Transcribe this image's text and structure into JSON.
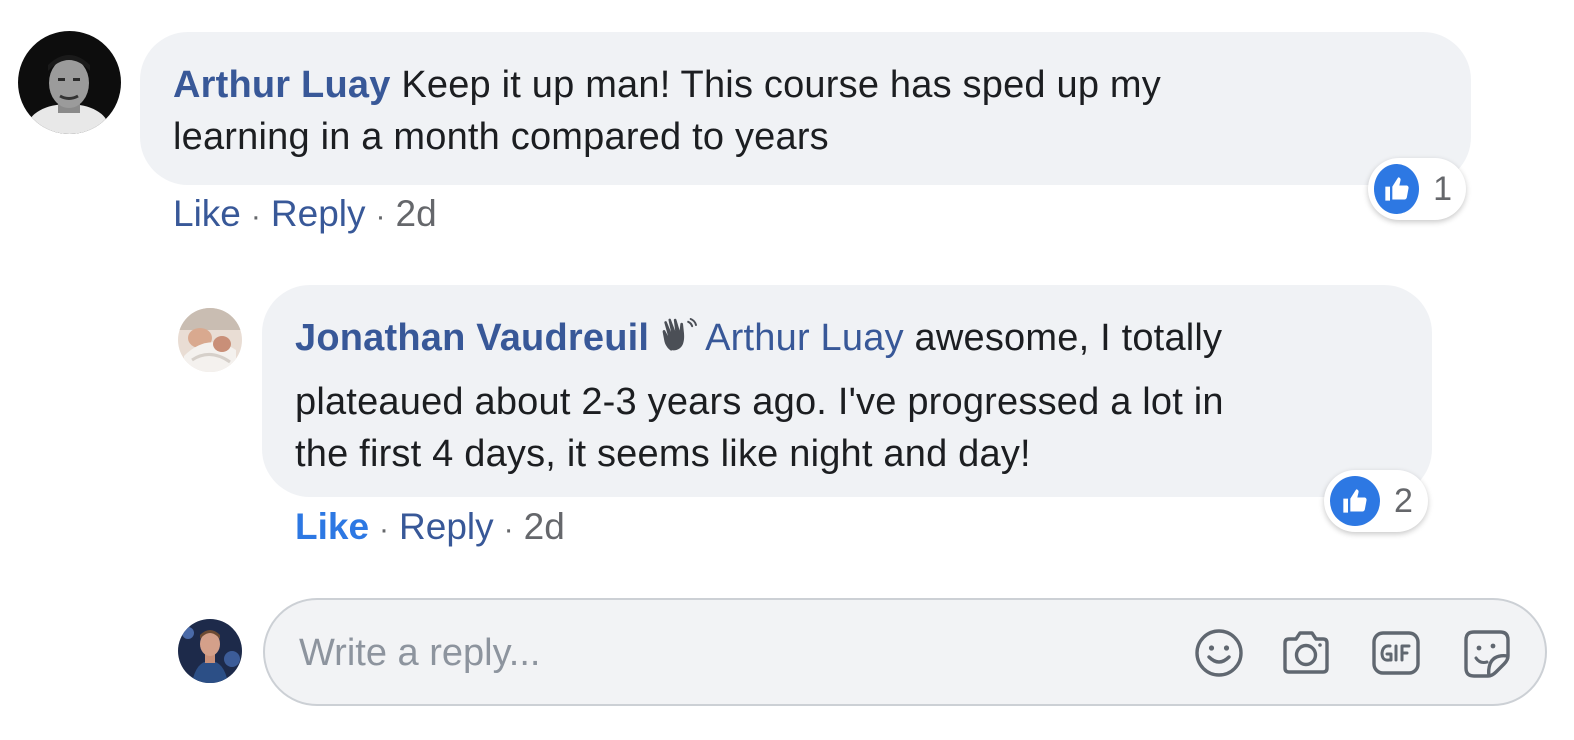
{
  "comment": {
    "author": "Arthur Luay",
    "text": "Keep it up man! This course has sped up my",
    "text_line2": "learning in a month compared to years",
    "reaction_count": "1",
    "actions": {
      "like": "Like",
      "reply": "Reply",
      "time": "2d",
      "separator": "·"
    }
  },
  "reply": {
    "author": "Jonathan Vaudreuil",
    "mention": "Arthur Luay",
    "text": "awesome, I totally",
    "text_line2": "plateaued about 2-3 years ago. I've progressed a lot in",
    "text_line3": "the first 4 days, it seems like night and day!",
    "reaction_count": "2",
    "actions": {
      "like": "Like",
      "reply": "Reply",
      "time": "2d",
      "separator": "·"
    }
  },
  "composer": {
    "placeholder": "Write a reply...",
    "icons": [
      "smiley-icon",
      "camera-icon",
      "gif-icon",
      "sticker-icon"
    ]
  },
  "colors": {
    "link": "#385898",
    "like_blue": "#2d78e3",
    "bubble": "#f0f2f5",
    "meta": "#65676b"
  }
}
